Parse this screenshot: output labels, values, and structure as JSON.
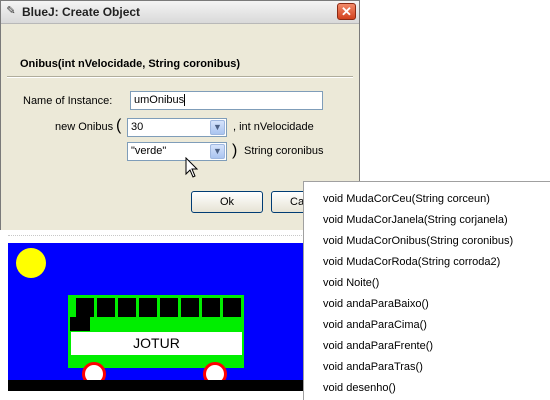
{
  "window": {
    "app_icon": "bluej-icon",
    "title": "BlueJ:  Create Object",
    "close_glyph": "✕"
  },
  "dialog": {
    "signature": "Onibus(int nVelocidade, String coronibus)",
    "instance_label": "Name of Instance:",
    "instance_value": "umOnibus",
    "constructor_label": "new Onibus",
    "open_paren": "(",
    "close_paren": ")",
    "param1": {
      "value": "30",
      "type_label": ", int nVelocidade"
    },
    "param2": {
      "value": "\"verde\"",
      "type_label": "String coronibus"
    },
    "ok_label": "Ok",
    "cancel_label": "Ca"
  },
  "canvas": {
    "background": "#0000ff",
    "sun_color": "#ffff00",
    "bus_color": "#00ee00",
    "wheel_color": "#ff0000",
    "bus_sign": "JOTUR"
  },
  "menu": {
    "items": [
      "void MudaCorCeu(String corceun)",
      "void MudaCorJanela(String corjanela)",
      "void MudaCorOnibus(String coronibus)",
      "void MudaCorRoda(String corroda2)",
      "void Noite()",
      "void andaParaBaixo()",
      "void andaParaCima()",
      "void andaParaFrente()",
      "void andaParaTras()",
      "void desenho()"
    ]
  }
}
